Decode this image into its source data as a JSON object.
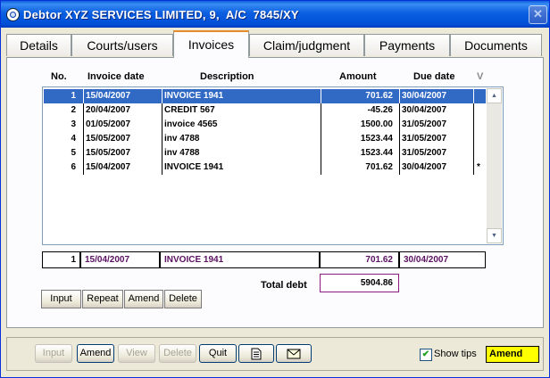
{
  "window": {
    "title": "Debtor XYZ SERVICES LIMITED, 9,  A/C  7845/XY",
    "close_glyph": "✕"
  },
  "tabs": [
    {
      "label": "Details"
    },
    {
      "label": "Courts/users"
    },
    {
      "label": "Invoices"
    },
    {
      "label": "Claim/judgment"
    },
    {
      "label": "Payments"
    },
    {
      "label": "Documents"
    }
  ],
  "grid": {
    "columns": [
      "No.",
      "Invoice date",
      "Description",
      "Amount",
      "Due date",
      "V"
    ],
    "rows": [
      {
        "no": "1",
        "date": "15/04/2007",
        "desc": "INVOICE 1941",
        "amount": "701.62",
        "due": "30/04/2007",
        "v": ""
      },
      {
        "no": "2",
        "date": "20/04/2007",
        "desc": "CREDIT 567",
        "amount": "-45.26",
        "due": "30/04/2007",
        "v": ""
      },
      {
        "no": "3",
        "date": "01/05/2007",
        "desc": "invoice 4565",
        "amount": "1500.00",
        "due": "31/05/2007",
        "v": ""
      },
      {
        "no": "4",
        "date": "15/05/2007",
        "desc": "inv 4788",
        "amount": "1523.44",
        "due": "31/05/2007",
        "v": ""
      },
      {
        "no": "5",
        "date": "15/05/2007",
        "desc": "inv 4788",
        "amount": "1523.44",
        "due": "31/05/2007",
        "v": ""
      },
      {
        "no": "6",
        "date": "15/04/2007",
        "desc": "INVOICE 1941",
        "amount": "701.62",
        "due": "30/04/2007",
        "v": "*"
      }
    ],
    "selected_row": 1
  },
  "current": {
    "no": "1",
    "date": "15/04/2007",
    "desc": "INVOICE 1941",
    "amount": "701.62",
    "due": "30/04/2007"
  },
  "total": {
    "label": "Total debt",
    "value": "5904.86"
  },
  "grid_buttons": {
    "input": "Input",
    "repeat": "Repeat",
    "amend": "Amend",
    "delete": "Delete"
  },
  "bottom_buttons": {
    "input": "Input",
    "amend": "Amend",
    "view": "View",
    "delete": "Delete",
    "quit": "Quit"
  },
  "icons": {
    "doc": "document-icon",
    "mail": "envelope-icon"
  },
  "show_tips": {
    "label": "Show tips",
    "checked": true
  },
  "mode": "Amend",
  "colors": {
    "selection": "#316ac5",
    "mode_bg": "#ffff00",
    "title_bar": "#0b5fe0"
  }
}
